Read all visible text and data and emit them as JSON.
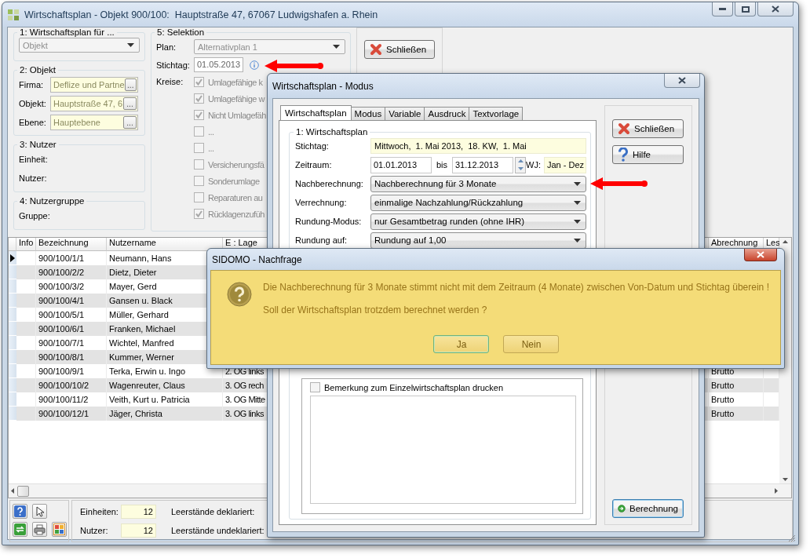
{
  "window": {
    "title": "Wirtschaftsplan - Objekt 900/100:  Hauptstraße 47, 67067 Ludwigshafen a. Rhein"
  },
  "plan_for": {
    "legend": "1: Wirtschaftsplan für ...",
    "value": "Objekt",
    "disabled": true
  },
  "objekt": {
    "legend": "2: Objekt",
    "fields": [
      {
        "label": "Firma:",
        "value": "Deflize und Partne",
        "button": "..."
      },
      {
        "label": "Objekt:",
        "value": "Hauptstraße 47, 6",
        "button": "..."
      },
      {
        "label": "Ebene:",
        "value": "Hauptebene",
        "button": "..."
      }
    ]
  },
  "nutzer": {
    "legend": "3: Nutzer",
    "labels": [
      "Einheit:",
      "Nutzer:"
    ]
  },
  "nutzergruppe": {
    "legend": "4: Nutzergruppe",
    "labels": [
      "Gruppe:"
    ]
  },
  "selektion": {
    "legend": "5: Selektion",
    "plan_label": "Plan:",
    "plan_value": "Alternativplan 1",
    "stichtag_label": "Stichtag:",
    "stichtag_value": "01.05.2013",
    "kreise_label": "Kreise:",
    "checkboxes": [
      {
        "label": "Umlagefähige k",
        "checked": true
      },
      {
        "label": "Umlagefähige w",
        "checked": true
      },
      {
        "label": "Nicht Umlagefäh",
        "checked": true
      },
      {
        "label": "...",
        "checked": false
      },
      {
        "label": "...",
        "checked": false
      },
      {
        "label": "Versicherungsfä",
        "checked": false
      },
      {
        "label": "Sonderumlage",
        "checked": false
      },
      {
        "label": "Reparaturen au",
        "checked": false
      },
      {
        "label": "Rücklagenzufüh",
        "checked": true
      }
    ]
  },
  "side_buttons": [
    {
      "label": "Schließen"
    }
  ],
  "table": {
    "columns": [
      "Info",
      "Bezeichnung",
      "Nutzername",
      "E : Lage",
      "Abrechnung",
      "Les"
    ],
    "rows": [
      {
        "current": true,
        "bezeichnung": "900/100/1/1",
        "nutzername": "Neumann, Hans"
      },
      {
        "current": false,
        "bezeichnung": "900/100/2/2",
        "nutzername": "Dietz, Dieter"
      },
      {
        "current": false,
        "bezeichnung": "900/100/3/2",
        "nutzername": "Mayer, Gerd"
      },
      {
        "current": false,
        "bezeichnung": "900/100/4/1",
        "nutzername": "Gansen u. Black"
      },
      {
        "current": false,
        "bezeichnung": "900/100/5/1",
        "nutzername": "Müller, Gerhard"
      },
      {
        "current": false,
        "bezeichnung": "900/100/6/1",
        "nutzername": "Franken, Michael"
      },
      {
        "current": false,
        "bezeichnung": "900/100/7/1",
        "nutzername": "Wichtel, Manfred"
      },
      {
        "current": false,
        "bezeichnung": "900/100/8/1",
        "nutzername": "Kummer, Werner"
      },
      {
        "current": false,
        "bezeichnung": "900/100/9/1",
        "nutzername": "Terka, Erwin u. Ingo",
        "lage": "2. OG links",
        "abrechnung": "Brutto"
      },
      {
        "current": false,
        "bezeichnung": "900/100/10/2",
        "nutzername": "Wagenreuter, Claus",
        "lage": "3. OG rech",
        "abrechnung": "Brutto"
      },
      {
        "current": false,
        "bezeichnung": "900/100/11/2",
        "nutzername": "Veith, Kurt u. Patricia",
        "lage": "3. OG Mitte",
        "abrechnung": "Brutto"
      },
      {
        "current": false,
        "bezeichnung": "900/100/12/1",
        "nutzername": "Jäger, Christa",
        "lage": "3. OG links",
        "abrechnung": "Brutto"
      }
    ]
  },
  "footer": {
    "einheiten_label": "Einheiten:",
    "einheiten": "12",
    "nutzer_label": "Nutzer:",
    "nutzer": "12",
    "deklariert_label": "Leerstände deklariert:",
    "undeklariert_label": "Leerstände undeklariert:"
  },
  "modus_dialog": {
    "title": "Wirtschaftsplan - Modus",
    "tabs": [
      {
        "label": "Wirtschaftsplan",
        "selected": true
      },
      {
        "label": "Modus",
        "selected": false
      },
      {
        "label": "Variable",
        "selected": false
      },
      {
        "label": "Ausdruck",
        "selected": false
      },
      {
        "label": "Textvorlage",
        "selected": false
      }
    ],
    "legend": "1: Wirtschaftsplan",
    "stichtag_label": "Stichtag:",
    "stichtag_value": "Mittwoch,  1. Mai 2013,  18. KW,  1. Mai",
    "zeitraum_label": "Zeitraum:",
    "from": "01.01.2013",
    "bis": "bis",
    "to": "31.12.2013",
    "wj_label": "WJ:",
    "wj": "Jan - Dez",
    "dropdowns": [
      {
        "label": "Nachberechnung:",
        "value": "Nachberechnung für 3 Monate"
      },
      {
        "label": "Verrechnung:",
        "value": "einmalige Nachzahlung/Rückzahlung"
      },
      {
        "label": "Rundung-Modus:",
        "value": "nur Gesamtbetrag runden (ohne IHR)"
      },
      {
        "label": "Rundung auf:",
        "value": "Rundung auf 1,00"
      }
    ],
    "remark": {
      "label": "Bemerkung zum Einzelwirtschaftsplan drucken",
      "checked": false
    },
    "buttons": [
      {
        "label": "Schließen"
      },
      {
        "label": "Hilfe"
      }
    ],
    "calc_button": {
      "label": "Berechnung"
    }
  },
  "message_dialog": {
    "title": "SIDOMO - Nachfrage",
    "lines": [
      "Die Nachberechnung für 3 Monate stimmt nicht mit dem Zeitraum (4 Monate) zwischen Von-Datum und Stichtag überein !",
      "Soll der Wirtschaftsplan trotzdem berechnet werden ?"
    ],
    "buttons": [
      {
        "label": "Ja",
        "focused": true
      },
      {
        "label": "Nein",
        "focused": false
      }
    ]
  }
}
